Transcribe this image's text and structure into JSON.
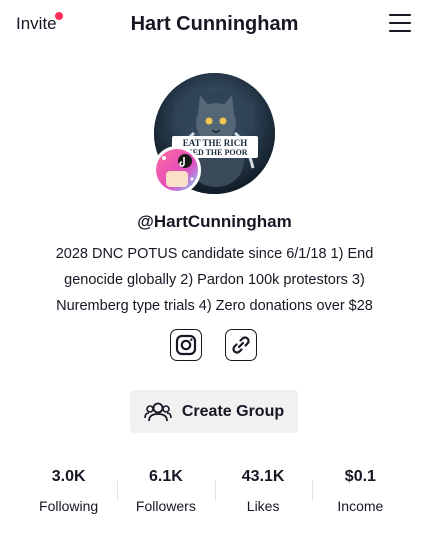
{
  "header": {
    "invite_label": "Invite",
    "title": "Hart Cunningham",
    "notification_dot_color": "#fe2c55"
  },
  "profile": {
    "avatar_text_line1": "EAT THE RICH",
    "avatar_text_line2": "FEED THE POOR",
    "handle": "@HartCunningham",
    "bio": "2028 DNC POTUS candidate since 6/1/18 1) End genocide globally 2) Pardon 100k protestors 3) Nuremberg type trials 4) Zero donations over $28"
  },
  "social": {
    "instagram_icon": "instagram-icon",
    "link_icon": "link-icon"
  },
  "actions": {
    "create_group_label": "Create Group"
  },
  "stats": [
    {
      "value": "3.0K",
      "label": "Following"
    },
    {
      "value": "6.1K",
      "label": "Followers"
    },
    {
      "value": "43.1K",
      "label": "Likes"
    },
    {
      "value": "$0.1",
      "label": "Income"
    }
  ]
}
